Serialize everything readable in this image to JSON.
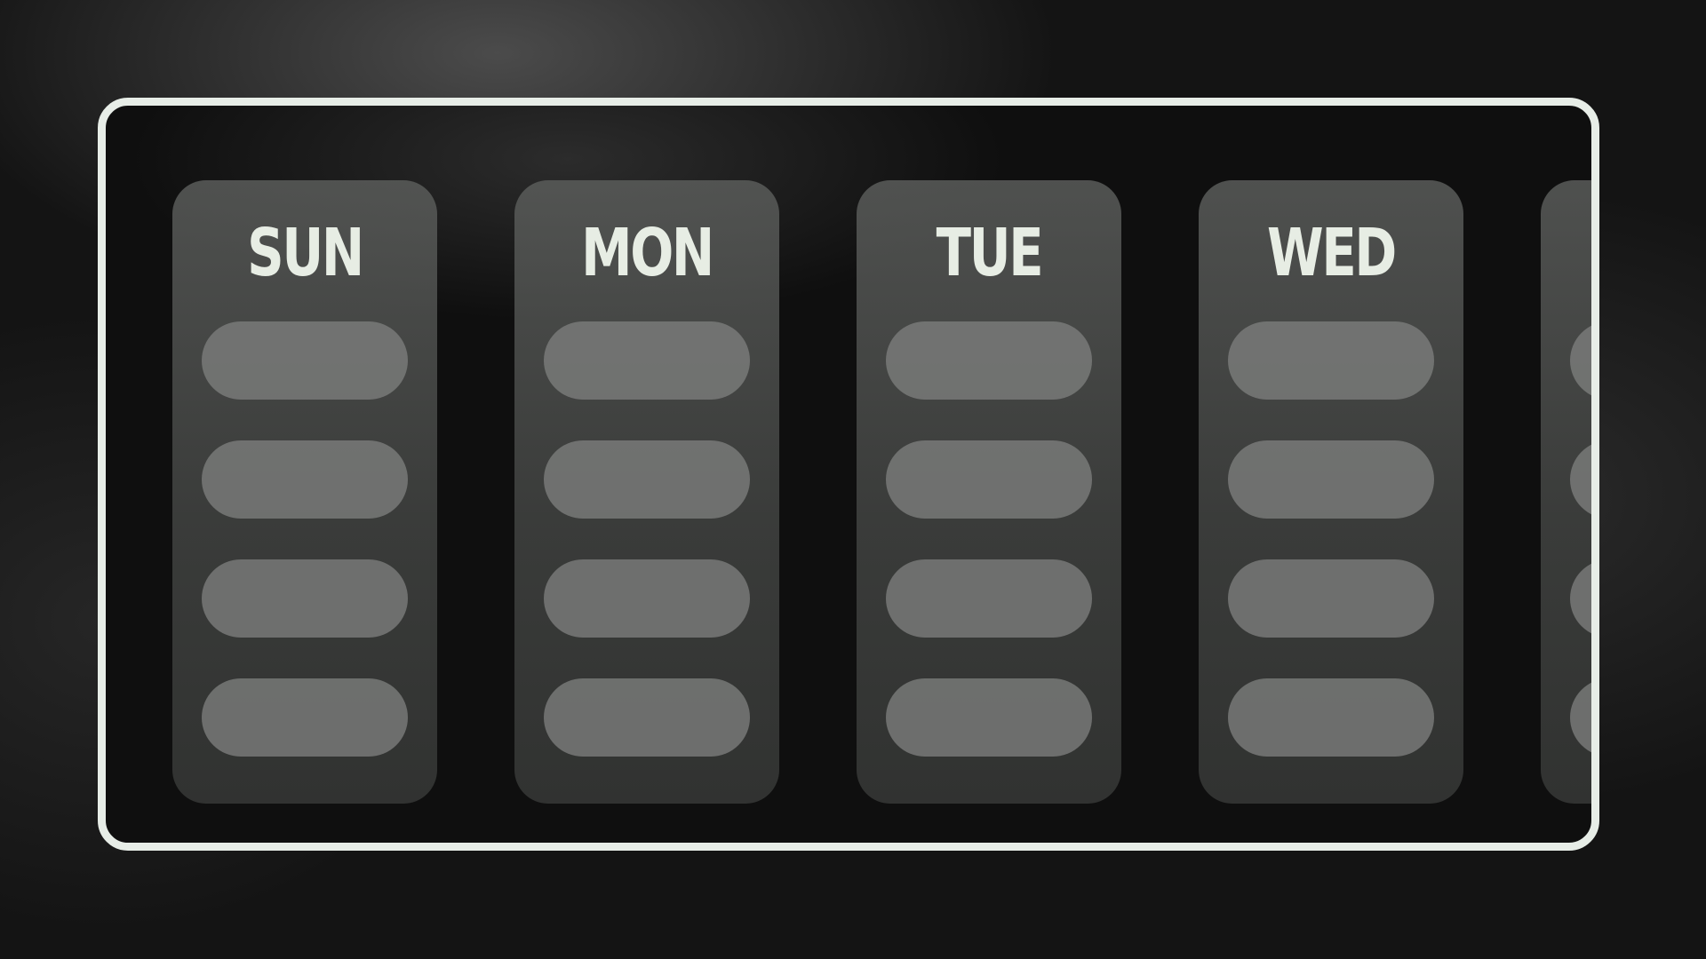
{
  "planner": {
    "days": [
      {
        "label": "SUN",
        "slots": 4
      },
      {
        "label": "MON",
        "slots": 4
      },
      {
        "label": "TUE",
        "slots": 4
      },
      {
        "label": "WED",
        "slots": 4
      },
      {
        "label": "",
        "slots": 4
      }
    ]
  },
  "colors": {
    "frame_border": "#e7ede7",
    "label_text": "#e7ede4",
    "background": "#141414"
  }
}
